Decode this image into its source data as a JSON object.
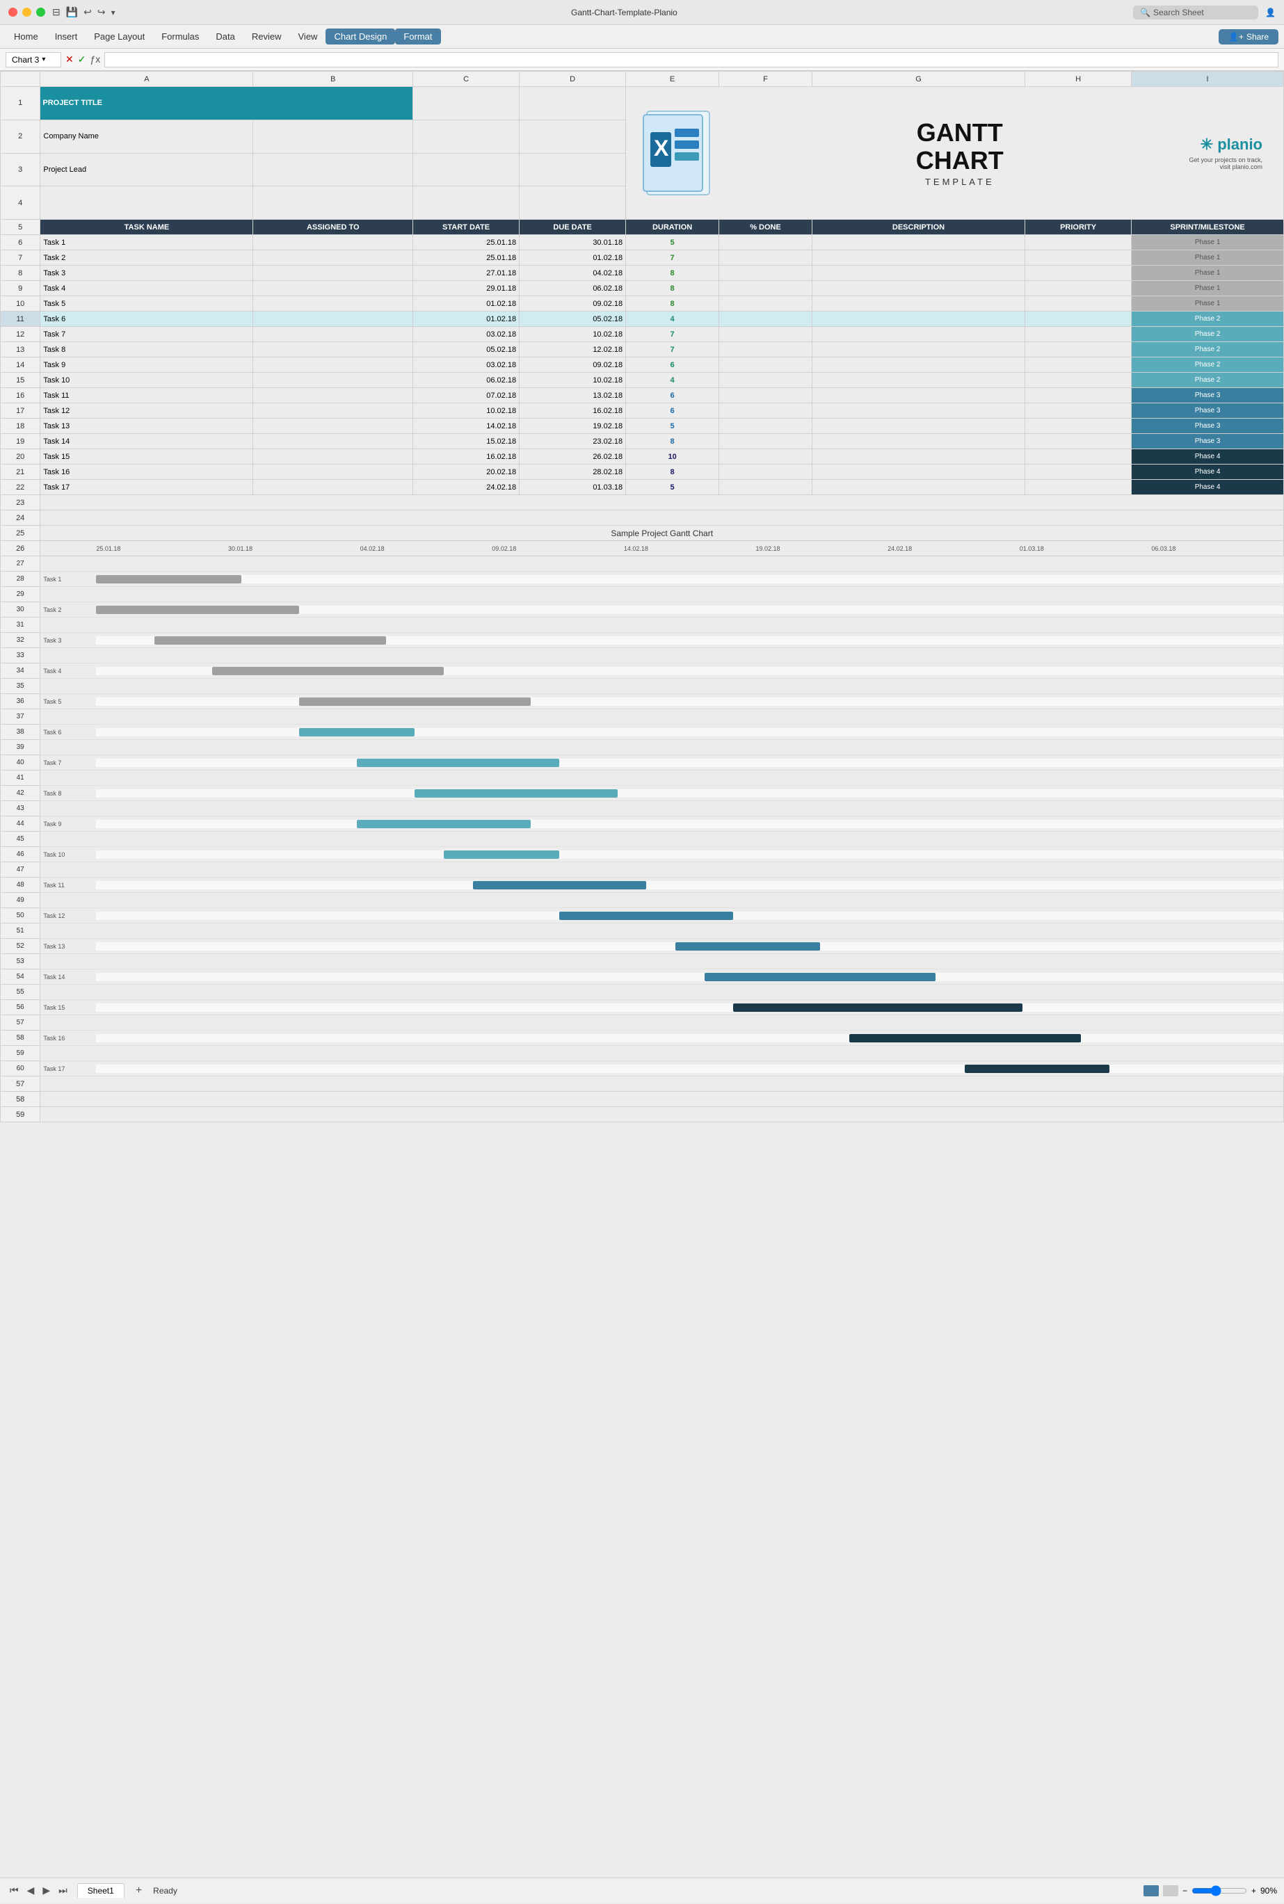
{
  "titleBar": {
    "title": "Gantt-Chart-Template-Planio",
    "searchPlaceholder": "Search Sheet"
  },
  "menuBar": {
    "items": [
      "Home",
      "Insert",
      "Page Layout",
      "Formulas",
      "Data",
      "Review",
      "View",
      "Chart Design",
      "Format"
    ],
    "activeItems": [
      "Chart Design",
      "Format"
    ],
    "shareLabel": "Share"
  },
  "formulaBar": {
    "cellName": "Chart 3",
    "formula": ""
  },
  "columns": {
    "headers": [
      "A",
      "B",
      "C",
      "D",
      "E",
      "F",
      "G",
      "H",
      "I"
    ],
    "taskHeaders": [
      "TASK NAME",
      "ASSIGNED TO",
      "START DATE",
      "DUE DATE",
      "DURATION",
      "% DONE",
      "DESCRIPTION",
      "PRIORITY",
      "SPRINT/MILESTONE"
    ]
  },
  "projectInfo": {
    "title": "PROJECT TITLE",
    "companyName": "Company Name",
    "projectLead": "Project Lead"
  },
  "tasks": [
    {
      "id": 1,
      "name": "Task 1",
      "start": "25.01.18",
      "due": "30.01.18",
      "duration": "5",
      "durClass": "dur-green",
      "phase": "Phase 1",
      "phaseClass": "phase-1"
    },
    {
      "id": 2,
      "name": "Task 2",
      "start": "25.01.18",
      "due": "01.02.18",
      "duration": "7",
      "durClass": "dur-green",
      "phase": "Phase 1",
      "phaseClass": "phase-1"
    },
    {
      "id": 3,
      "name": "Task 3",
      "start": "27.01.18",
      "due": "04.02.18",
      "duration": "8",
      "durClass": "dur-green",
      "phase": "Phase 1",
      "phaseClass": "phase-1"
    },
    {
      "id": 4,
      "name": "Task 4",
      "start": "29.01.18",
      "due": "06.02.18",
      "duration": "8",
      "durClass": "dur-green",
      "phase": "Phase 1",
      "phaseClass": "phase-1"
    },
    {
      "id": 5,
      "name": "Task 5",
      "start": "01.02.18",
      "due": "09.02.18",
      "duration": "8",
      "durClass": "dur-green",
      "phase": "Phase 1",
      "phaseClass": "phase-1"
    },
    {
      "id": 6,
      "name": "Task 6",
      "start": "01.02.18",
      "due": "05.02.18",
      "duration": "4",
      "durClass": "dur-teal",
      "phase": "Phase 2",
      "phaseClass": "phase-2"
    },
    {
      "id": 7,
      "name": "Task 7",
      "start": "03.02.18",
      "due": "10.02.18",
      "duration": "7",
      "durClass": "dur-teal",
      "phase": "Phase 2",
      "phaseClass": "phase-2"
    },
    {
      "id": 8,
      "name": "Task 8",
      "start": "05.02.18",
      "due": "12.02.18",
      "duration": "7",
      "durClass": "dur-teal",
      "phase": "Phase 2",
      "phaseClass": "phase-2"
    },
    {
      "id": 9,
      "name": "Task 9",
      "start": "03.02.18",
      "due": "09.02.18",
      "duration": "6",
      "durClass": "dur-teal",
      "phase": "Phase 2",
      "phaseClass": "phase-2"
    },
    {
      "id": 10,
      "name": "Task 10",
      "start": "06.02.18",
      "due": "10.02.18",
      "duration": "4",
      "durClass": "dur-teal",
      "phase": "Phase 2",
      "phaseClass": "phase-2"
    },
    {
      "id": 11,
      "name": "Task 11",
      "start": "07.02.18",
      "due": "13.02.18",
      "duration": "6",
      "durClass": "dur-blue",
      "phase": "Phase 3",
      "phaseClass": "phase-3"
    },
    {
      "id": 12,
      "name": "Task 12",
      "start": "10.02.18",
      "due": "16.02.18",
      "duration": "6",
      "durClass": "dur-blue",
      "phase": "Phase 3",
      "phaseClass": "phase-3"
    },
    {
      "id": 13,
      "name": "Task 13",
      "start": "14.02.18",
      "due": "19.02.18",
      "duration": "5",
      "durClass": "dur-blue",
      "phase": "Phase 3",
      "phaseClass": "phase-3"
    },
    {
      "id": 14,
      "name": "Task 14",
      "start": "15.02.18",
      "due": "23.02.18",
      "duration": "8",
      "durClass": "dur-blue",
      "phase": "Phase 3",
      "phaseClass": "phase-3"
    },
    {
      "id": 15,
      "name": "Task 15",
      "start": "16.02.18",
      "due": "26.02.18",
      "duration": "10",
      "durClass": "dur-dark",
      "phase": "Phase 4",
      "phaseClass": "phase-4"
    },
    {
      "id": 16,
      "name": "Task 16",
      "start": "20.02.18",
      "due": "28.02.18",
      "duration": "8",
      "durClass": "dur-dark",
      "phase": "Phase 4",
      "phaseClass": "phase-4"
    },
    {
      "id": 17,
      "name": "Task 17",
      "start": "24.02.18",
      "due": "01.03.18",
      "duration": "5",
      "durClass": "dur-dark",
      "phase": "Phase 4",
      "phaseClass": "phase-4"
    }
  ],
  "ganttChart": {
    "title": "Sample Project Gantt Chart",
    "dateLabels": [
      "25.01.18",
      "30.01.18",
      "04.02.18",
      "09.02.18",
      "14.02.18",
      "19.02.18",
      "24.02.18",
      "01.03.18",
      "06.03.18"
    ],
    "bars": [
      {
        "task": "Task 1",
        "start": 0,
        "width": 5,
        "phase": 1
      },
      {
        "task": "Task 2",
        "start": 0,
        "width": 7,
        "phase": 1
      },
      {
        "task": "Task 3",
        "start": 2,
        "width": 8,
        "phase": 1
      },
      {
        "task": "Task 4",
        "start": 4,
        "width": 8,
        "phase": 1
      },
      {
        "task": "Task 5",
        "start": 7,
        "width": 8,
        "phase": 1
      },
      {
        "task": "Task 6",
        "start": 7,
        "width": 4,
        "phase": 2
      },
      {
        "task": "Task 7",
        "start": 9,
        "width": 7,
        "phase": 2
      },
      {
        "task": "Task 8",
        "start": 11,
        "width": 7,
        "phase": 2
      },
      {
        "task": "Task 9",
        "start": 9,
        "width": 6,
        "phase": 2
      },
      {
        "task": "Task 10",
        "start": 12,
        "width": 4,
        "phase": 2
      },
      {
        "task": "Task 11",
        "start": 13,
        "width": 6,
        "phase": 3
      },
      {
        "task": "Task 12",
        "start": 16,
        "width": 6,
        "phase": 3
      },
      {
        "task": "Task 13",
        "start": 20,
        "width": 5,
        "phase": 3
      },
      {
        "task": "Task 14",
        "start": 21,
        "width": 8,
        "phase": 3
      },
      {
        "task": "Task 15",
        "start": 22,
        "width": 10,
        "phase": 4
      },
      {
        "task": "Task 16",
        "start": 26,
        "width": 8,
        "phase": 4
      },
      {
        "task": "Task 17",
        "start": 30,
        "width": 5,
        "phase": 4
      }
    ]
  },
  "bottomBar": {
    "status": "Ready",
    "sheetName": "Sheet1",
    "zoom": "90%"
  }
}
